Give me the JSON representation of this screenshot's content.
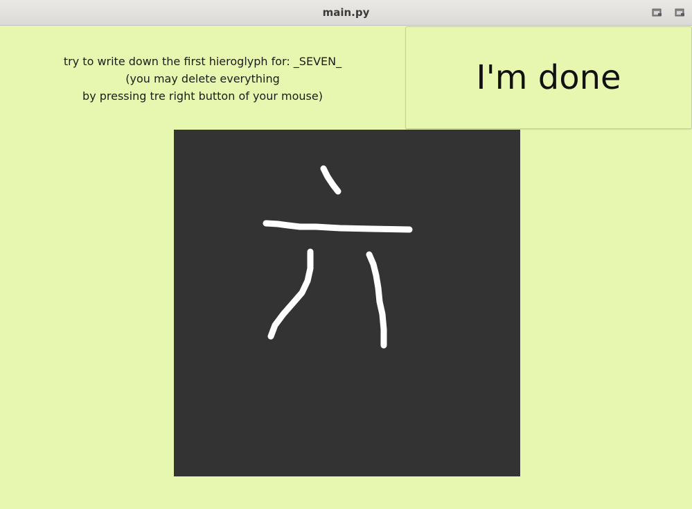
{
  "window": {
    "title": "main.py",
    "controls": [
      {
        "name": "restore-window-icon"
      },
      {
        "name": "maximize-window-icon"
      }
    ]
  },
  "instruction": {
    "line1": "try to write down the first hieroglyph for: _SEVEN_",
    "line2": "(you may delete everything",
    "line3": "by pressing tre right button of your mouse)"
  },
  "done_button": {
    "label": "I'm done"
  },
  "drawing_canvas": {
    "background_color": "#333333",
    "stroke_color": "#ffffff"
  },
  "colors": {
    "app_background": "#e8f7b0"
  }
}
